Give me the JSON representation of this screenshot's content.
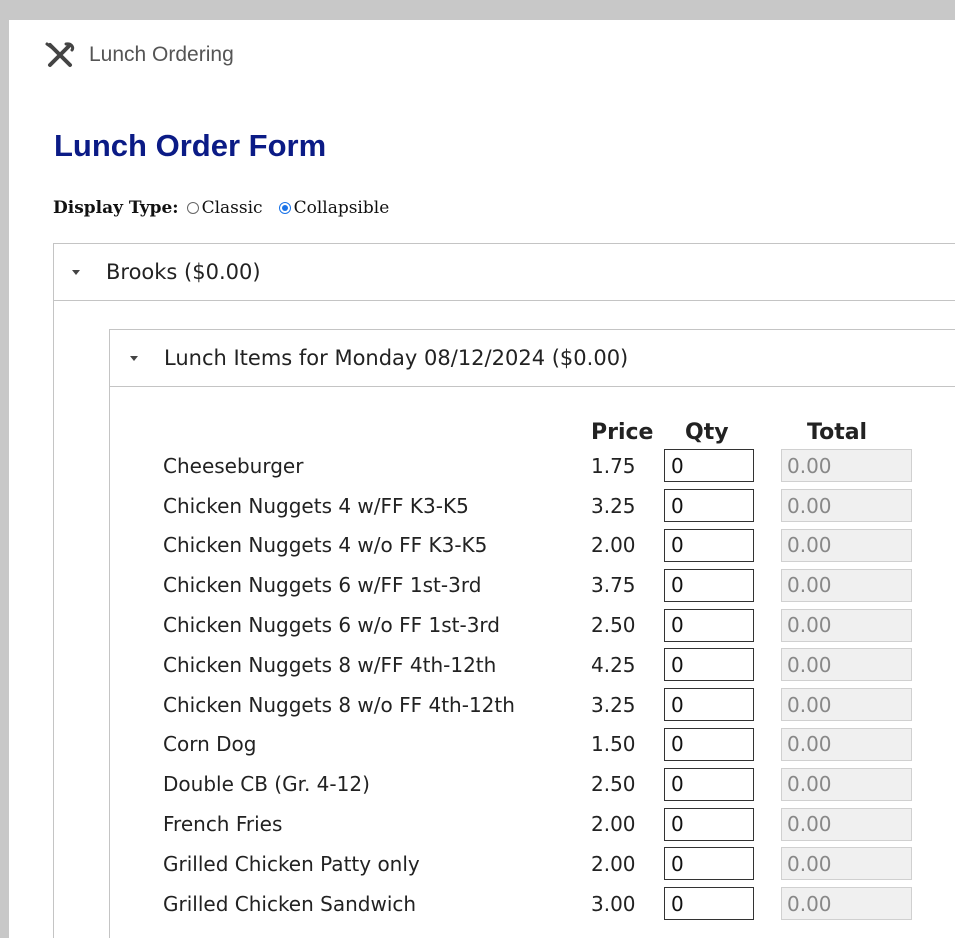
{
  "app": {
    "title": "Lunch Ordering",
    "icon": "utensils-icon"
  },
  "form": {
    "title": "Lunch Order Form",
    "display_type": {
      "label": "Display Type:",
      "options": [
        {
          "label": "Classic",
          "checked": false
        },
        {
          "label": "Collapsible",
          "checked": true
        }
      ]
    }
  },
  "location": {
    "label": "Brooks ($0.00)",
    "day": {
      "label": "Lunch Items for Monday 08/12/2024 ($0.00)",
      "columns": {
        "price": "Price",
        "qty": "Qty",
        "total": "Total"
      },
      "items": [
        {
          "name": "Cheeseburger",
          "price": "1.75",
          "qty": "0",
          "total": "0.00"
        },
        {
          "name": "Chicken Nuggets 4 w/FF K3-K5",
          "price": "3.25",
          "qty": "0",
          "total": "0.00"
        },
        {
          "name": "Chicken Nuggets 4 w/o FF K3-K5",
          "price": "2.00",
          "qty": "0",
          "total": "0.00"
        },
        {
          "name": "Chicken Nuggets 6 w/FF 1st-3rd",
          "price": "3.75",
          "qty": "0",
          "total": "0.00"
        },
        {
          "name": "Chicken Nuggets 6 w/o FF 1st-3rd",
          "price": "2.50",
          "qty": "0",
          "total": "0.00"
        },
        {
          "name": "Chicken Nuggets 8 w/FF 4th-12th",
          "price": "4.25",
          "qty": "0",
          "total": "0.00"
        },
        {
          "name": "Chicken Nuggets 8 w/o FF 4th-12th",
          "price": "3.25",
          "qty": "0",
          "total": "0.00"
        },
        {
          "name": "Corn Dog",
          "price": "1.50",
          "qty": "0",
          "total": "0.00"
        },
        {
          "name": "Double CB (Gr. 4-12)",
          "price": "2.50",
          "qty": "0",
          "total": "0.00"
        },
        {
          "name": "French Fries",
          "price": "2.00",
          "qty": "0",
          "total": "0.00"
        },
        {
          "name": "Grilled Chicken Patty only",
          "price": "2.00",
          "qty": "0",
          "total": "0.00"
        },
        {
          "name": "Grilled Chicken Sandwich",
          "price": "3.00",
          "qty": "0",
          "total": "0.00"
        }
      ]
    }
  }
}
